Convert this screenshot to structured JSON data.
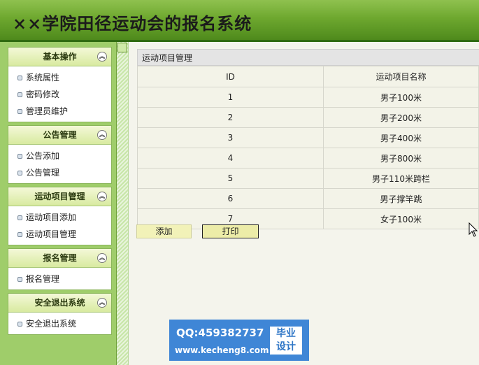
{
  "header": {
    "title": "××学院田径运动会的报名系统"
  },
  "sidebar": {
    "menus": [
      {
        "title": "基本操作",
        "items": [
          "系统属性",
          "密码修改",
          "管理员维护"
        ]
      },
      {
        "title": "公告管理",
        "items": [
          "公告添加",
          "公告管理"
        ]
      },
      {
        "title": "运动项目管理",
        "items": [
          "运动项目添加",
          "运动项目管理"
        ]
      },
      {
        "title": "报名管理",
        "items": [
          "报名管理"
        ]
      },
      {
        "title": "安全退出系统",
        "items": [
          "安全退出系统"
        ]
      }
    ],
    "toggle_glyph": "︽"
  },
  "main": {
    "panel_title": "运动项目管理",
    "table": {
      "headers": [
        "ID",
        "运动项目名称"
      ],
      "rows": [
        [
          "1",
          "男子100米"
        ],
        [
          "2",
          "男子200米"
        ],
        [
          "3",
          "男子400米"
        ],
        [
          "4",
          "男子800米"
        ],
        [
          "5",
          "男子110米跨栏"
        ],
        [
          "6",
          "男子撑竿跳"
        ],
        [
          "7",
          "女子100米"
        ]
      ]
    },
    "buttons": {
      "add": "添加",
      "print": "打印"
    }
  },
  "watermark": {
    "qq": "QQ:459382737",
    "url": "www.kecheng8.com",
    "badge_line1": "毕业",
    "badge_line2": "设计"
  },
  "colors": {
    "header_green": "#6ea82f",
    "sidebar_green": "#9fcd6a",
    "watermark_blue": "#3f86d6"
  }
}
